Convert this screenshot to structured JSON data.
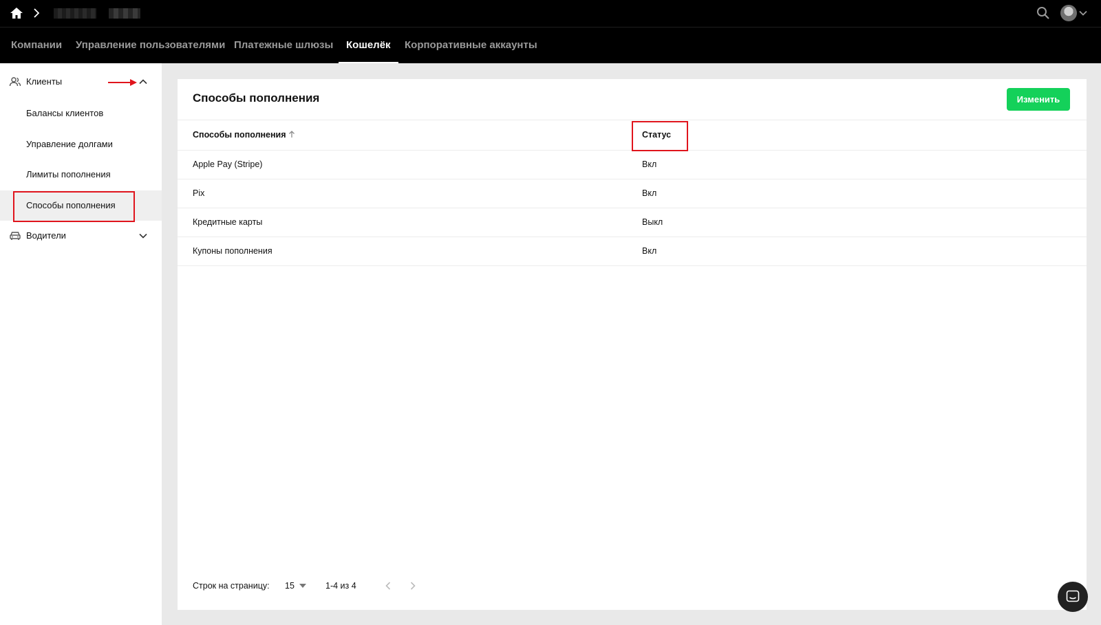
{
  "nav": {
    "tabs": [
      {
        "label": "Компании",
        "active": false
      },
      {
        "label": "Управление пользователями",
        "active": false
      },
      {
        "label": "Платежные шлюзы",
        "active": false
      },
      {
        "label": "Кошелёк",
        "active": true
      },
      {
        "label": "Корпоративные аккаунты",
        "active": false
      }
    ]
  },
  "sidebar": {
    "groups": [
      {
        "label": "Клиенты",
        "icon": "users-icon",
        "expanded": true
      },
      {
        "label": "Водители",
        "icon": "car-icon",
        "expanded": false
      }
    ],
    "items": [
      {
        "label": "Балансы клиентов"
      },
      {
        "label": "Управление долгами"
      },
      {
        "label": "Лимиты пополнения"
      },
      {
        "label": "Способы пополнения",
        "active": true
      }
    ]
  },
  "main": {
    "title": "Способы пополнения",
    "edit_label": "Изменить",
    "columns": [
      "Способы пополнения",
      "Статус"
    ],
    "rows": [
      {
        "method": "Apple Pay (Stripe)",
        "status": "Вкл"
      },
      {
        "method": "Pix",
        "status": "Вкл"
      },
      {
        "method": "Кредитные карты",
        "status": "Выкл"
      },
      {
        "method": "Купоны пополнения",
        "status": "Вкл"
      }
    ]
  },
  "pagination": {
    "rows_per_page_label": "Строк на страницу:",
    "rows_per_page": "15",
    "range": "1-4 из 4"
  },
  "colors": {
    "accent": "#14d15a",
    "annotation": "#e0141c",
    "topbar": "#000000"
  }
}
